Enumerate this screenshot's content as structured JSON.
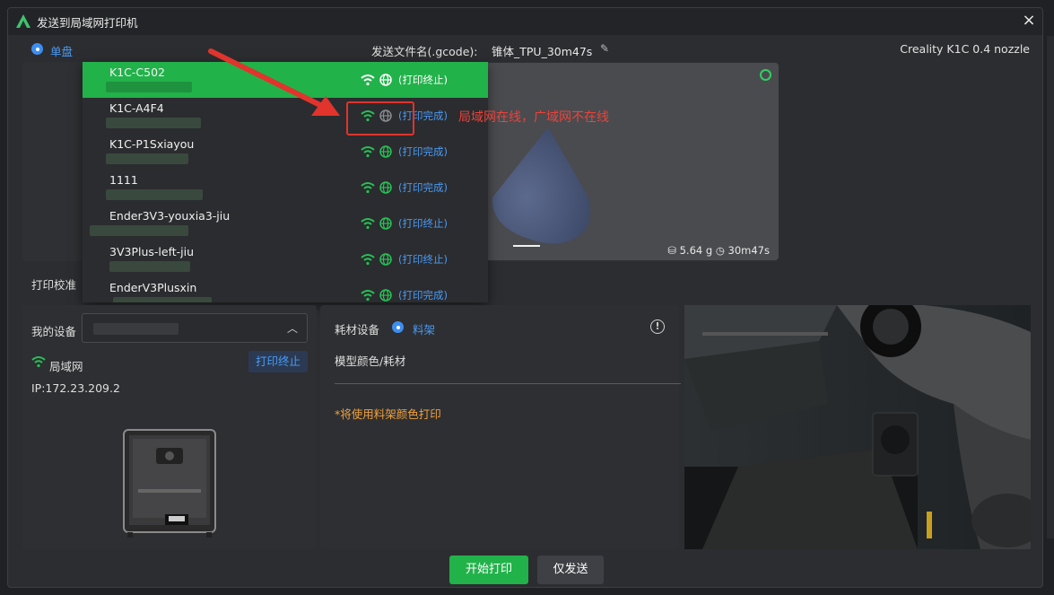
{
  "window": {
    "title": "发送到局域网打印机"
  },
  "topbar": {
    "mode_label": "单盘",
    "file_label": "发送文件名(.gcode):",
    "file_value": "锥体_TPU_30m47s",
    "printer_model": "Creality K1C 0.4 nozzle"
  },
  "preview": {
    "weight": "5.64 g",
    "time": "30m47s"
  },
  "calibration_label": "打印校准",
  "dropdown": {
    "items": [
      {
        "name": "K1C-C502",
        "status": "(打印终止)",
        "selected": true
      },
      {
        "name": "K1C-A4F4",
        "status": "(打印完成)",
        "wan_online": false
      },
      {
        "name": "K1C-P1Sxiayou",
        "status": "(打印完成)"
      },
      {
        "name": "1111",
        "status": "(打印完成)"
      },
      {
        "name": "Ender3V3-youxia3-jiu",
        "status": "(打印终止)"
      },
      {
        "name": "3V3Plus-left-jiu",
        "status": "(打印终止)"
      },
      {
        "name": "EnderV3Plusxin",
        "status": "(打印完成)"
      }
    ]
  },
  "annotation": {
    "text": "局域网在线，广域网不在线"
  },
  "device_panel": {
    "label": "我的设备",
    "network_label": "局域网",
    "status_badge": "打印终止",
    "ip": "IP:172.23.209.2"
  },
  "filament_panel": {
    "label": "耗材设备",
    "rack_label": "料架",
    "model_color_label": "模型颜色/耗材",
    "note": "*将使用料架颜色打印"
  },
  "buttons": {
    "start": "开始打印",
    "send": "仅发送"
  },
  "colors": {
    "accent_green": "#22b24a",
    "accent_blue": "#4a9af4",
    "annotation_red": "#e0342c",
    "note_orange": "#f0a13c"
  }
}
